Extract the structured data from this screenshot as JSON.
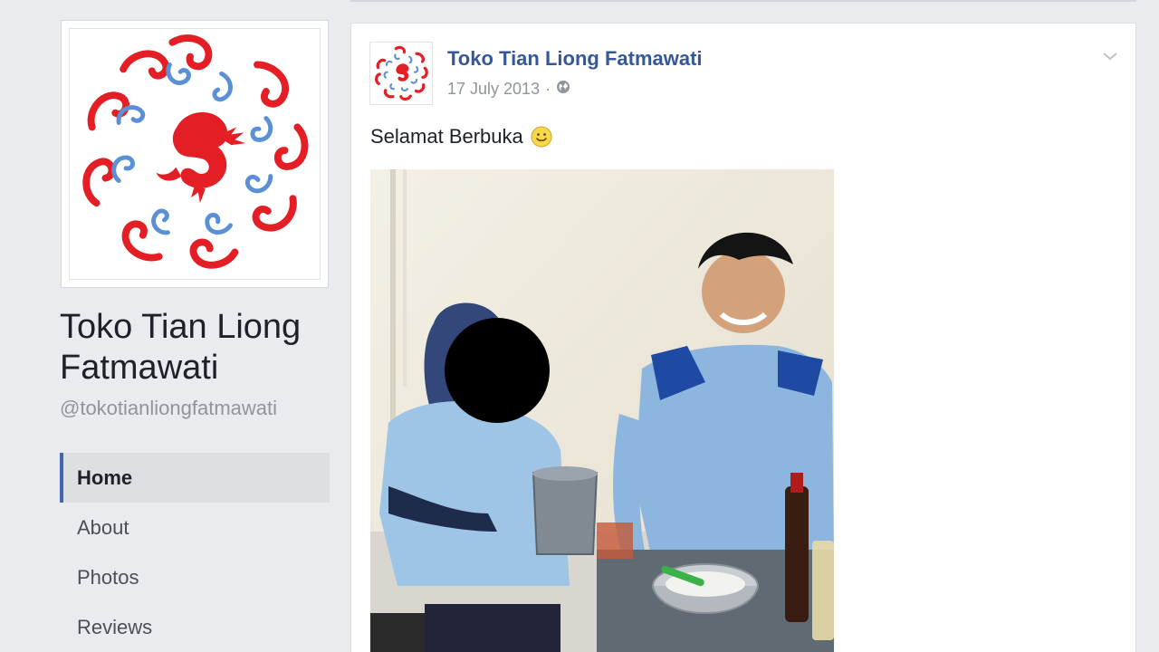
{
  "page": {
    "name": "Toko Tian Liong Fatmawati",
    "handle": "@tokotianliongfatmawati"
  },
  "nav": {
    "items": [
      {
        "label": "Home",
        "active": true
      },
      {
        "label": "About",
        "active": false
      },
      {
        "label": "Photos",
        "active": false
      },
      {
        "label": "Reviews",
        "active": false
      }
    ]
  },
  "post": {
    "author": "Toko Tian Liong Fatmawati",
    "date": "17 July 2013",
    "separator": "·",
    "privacy_icon": "globe-icon",
    "text": "Selamat Berbuka",
    "emoji": "smile-emoji-icon"
  },
  "colors": {
    "background": "#e9ebee",
    "link_blue": "#365899",
    "accent": "#4267b2",
    "logo_red": "#e31e24",
    "logo_blue": "#5b8fd6"
  }
}
